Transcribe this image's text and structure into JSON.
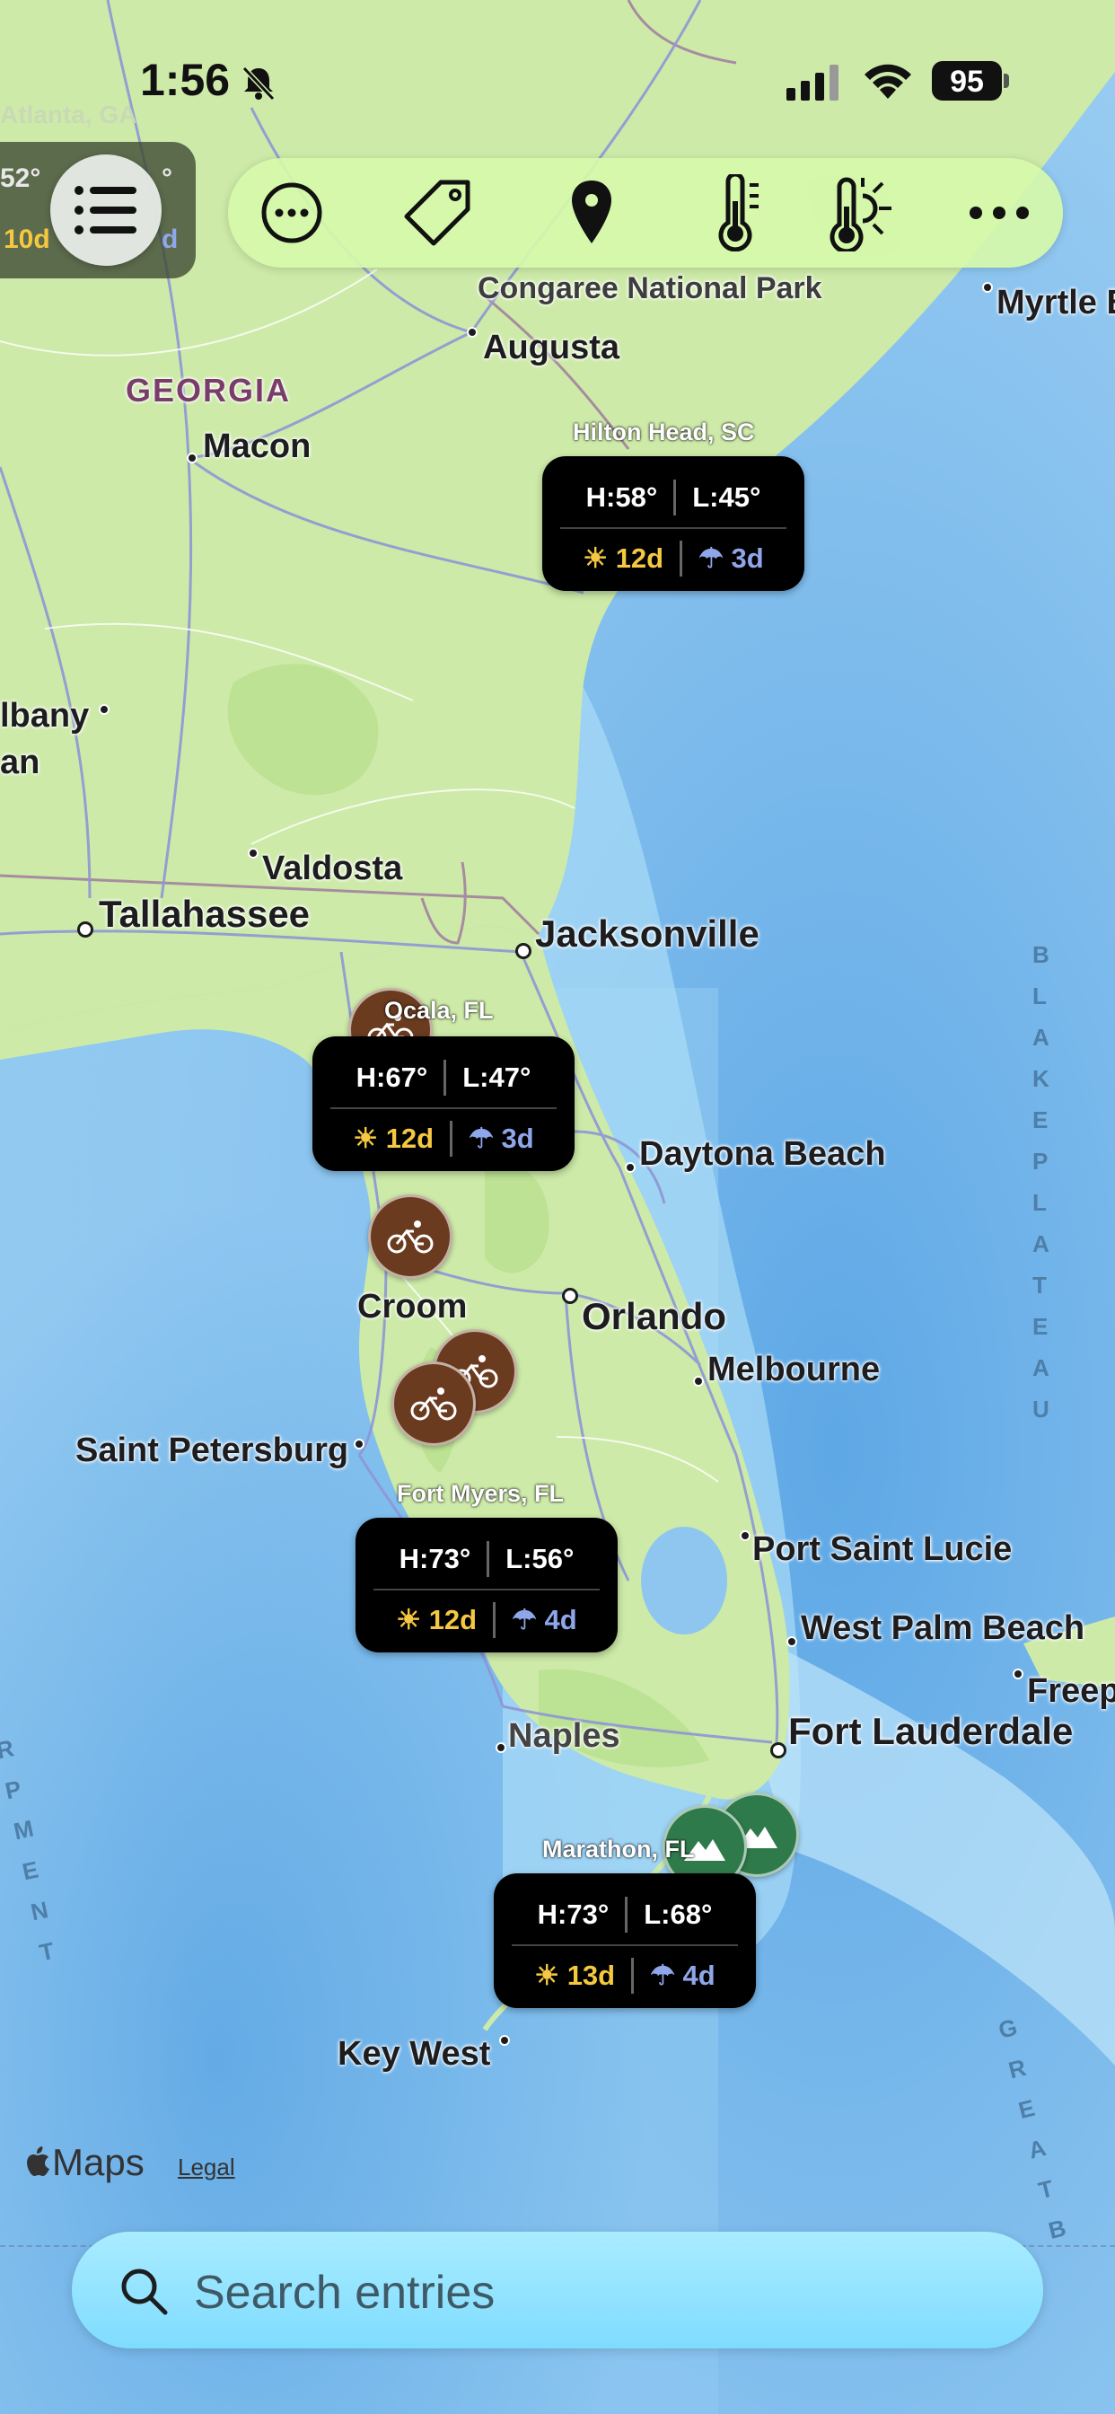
{
  "status_bar": {
    "time": "1:56",
    "battery": "95"
  },
  "left_panel": {
    "temp_fragment": "52°",
    "days_fragment": "10d",
    "days_fragment2": "d",
    "temp_fragment2": "°",
    "offscreen_city": "Atlanta, GA"
  },
  "toolbar": {
    "buttons": [
      "more-circle-icon",
      "tag-icon",
      "location-pin-icon",
      "thermometer-icon",
      "thermometer-sun-icon",
      "ellipsis-icon"
    ]
  },
  "map_labels": {
    "park": "Congaree National Park",
    "state": "GEORGIA",
    "cities": {
      "augusta": "Augusta",
      "macon": "Macon",
      "albany": "Albany",
      "albany_frag": "lbany",
      "an_frag": "an",
      "valdosta": "Valdosta",
      "tallahassee": "Tallahassee",
      "jacksonville": "Jacksonville",
      "daytona": "Daytona Beach",
      "croom": "Croom",
      "orlando": "Orlando",
      "melbourne": "Melbourne",
      "saint_petersburg": "Saint Petersburg",
      "port_saint_lucie": "Port Saint Lucie",
      "west_palm_beach": "West Palm Beach",
      "freeport_frag": "Freep",
      "naples": "Naples",
      "fort_lauderdale": "Fort Lauderdale",
      "key_west": "Key West",
      "myrtle_frag": "Myrtle B"
    },
    "sea": {
      "blake_plateau": "BLAKE PLATEAU",
      "escarpment_frag": "RPMENT",
      "great_frag": "GREAT B"
    }
  },
  "weather_cards": [
    {
      "location": "Hilton Head, SC",
      "high": "H:58°",
      "low": "L:45°",
      "sun_days": "12d",
      "rain_days": "3d"
    },
    {
      "location": "Ocala, FL",
      "high": "H:67°",
      "low": "L:47°",
      "sun_days": "12d",
      "rain_days": "3d"
    },
    {
      "location": "Fort Myers, FL",
      "high": "H:73°",
      "low": "L:56°",
      "sun_days": "12d",
      "rain_days": "4d"
    },
    {
      "location": "Marathon, FL",
      "high": "H:73°",
      "low": "L:68°",
      "sun_days": "13d",
      "rain_days": "4d"
    }
  ],
  "attribution": {
    "maps": "Maps",
    "legal": "Legal"
  },
  "search": {
    "placeholder": "Search entries"
  },
  "colors": {
    "land": "#cdeaa8",
    "water": "#8fc6ef",
    "card": "#000000",
    "sun": "#f5c842",
    "rain": "#8fa6ea",
    "bike_pin": "#6b3b1f",
    "mountain_pin": "#2f7a4a",
    "toolbar": "#d6f8aa"
  }
}
